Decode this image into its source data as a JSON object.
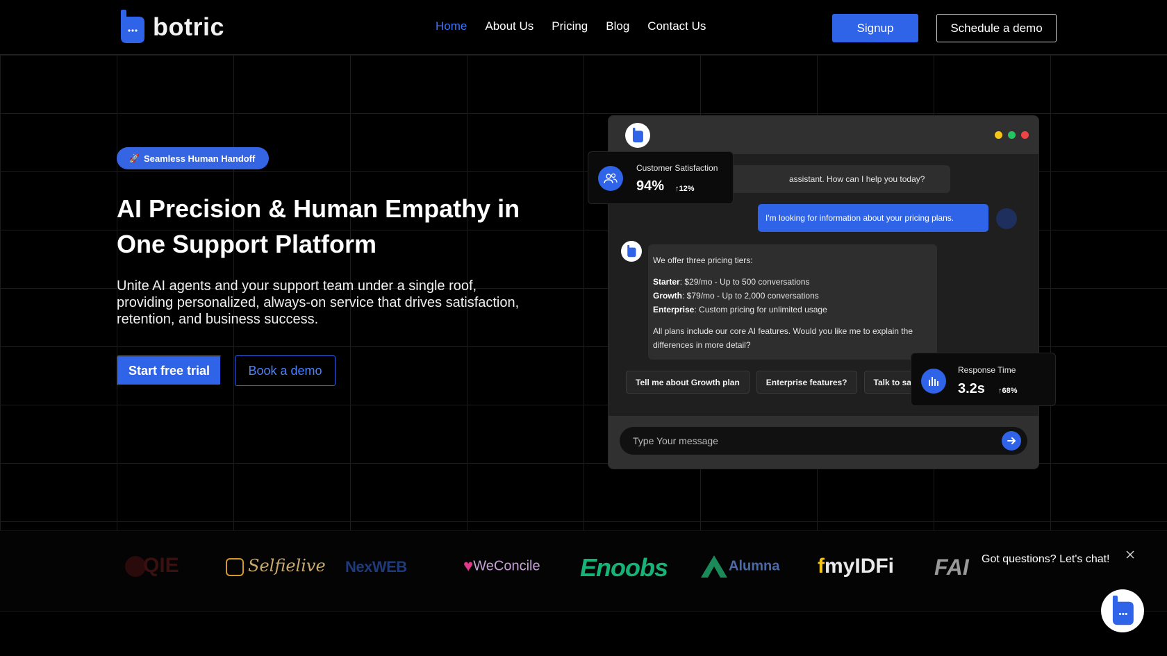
{
  "brand": {
    "name": "botric"
  },
  "nav": {
    "links": [
      {
        "label": "Home",
        "active": true
      },
      {
        "label": "About Us"
      },
      {
        "label": "Pricing"
      },
      {
        "label": "Blog"
      },
      {
        "label": "Contact Us"
      }
    ],
    "signup_label": "Signup",
    "schedule_label": "Schedule a demo"
  },
  "hero": {
    "badge": "Seamless Human Handoff",
    "badge_icon": "rocket-icon",
    "title": "AI Precision & Human Empathy in One Support Platform",
    "subtitle": "Unite AI agents and your support team under a single roof, providing personalized, always-on service that drives satisfaction, retention, and business success.",
    "primary_cta": "Start free trial",
    "secondary_cta": "Book a demo"
  },
  "chat_demo": {
    "window_dots": [
      "#f5c518",
      "#22c55e",
      "#ef4444"
    ],
    "bot_greeting_visible": "assistant. How can I help you today?",
    "user_message": "I'm looking for information about your pricing plans.",
    "bot_reply": {
      "intro": "We offer three pricing tiers:",
      "tiers": [
        {
          "name": "Starter",
          "detail": ": $29/mo - Up to 500 conversations"
        },
        {
          "name": "Growth",
          "detail": ": $79/mo - Up to 2,000 conversations"
        },
        {
          "name": "Enterprise",
          "detail": ": Custom pricing for unlimited usage"
        }
      ],
      "outro": "All plans include our core AI features. Would you like me to explain the differences in more detail?"
    },
    "quick_replies": [
      "Tell me about Growth plan",
      "Enterprise features?",
      "Talk to sale"
    ],
    "input_placeholder": "Type Your message"
  },
  "stats": {
    "satisfaction": {
      "label": "Customer Satisfaction",
      "value": "94%",
      "change": "12%"
    },
    "response_time": {
      "label": "Response Time",
      "value": "3.2s",
      "change": "68%"
    }
  },
  "partner_logos": [
    "QIE",
    "Selfielive",
    "NexWEB",
    "WeConcile",
    "Enoobs",
    "Alumna",
    "myIDFi",
    "FAI"
  ],
  "chat_widget": {
    "prompt": "Got questions? Let's chat!"
  },
  "colors": {
    "accent": "#2f63e8",
    "active_link": "#3b74ff",
    "background": "#000000"
  }
}
